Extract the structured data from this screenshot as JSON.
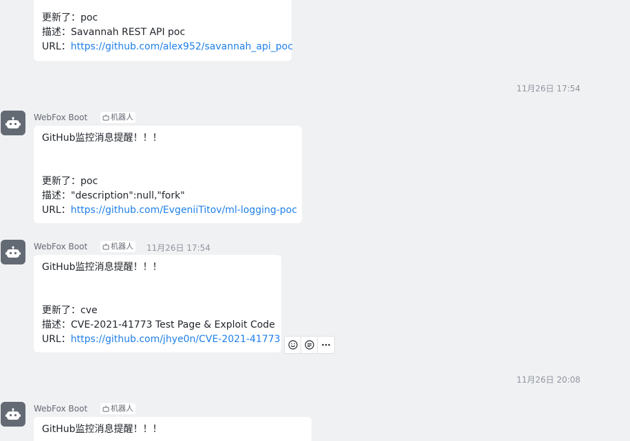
{
  "messages": [
    {
      "line_update": "更新了：poc",
      "desc": "描述：Savannah REST API poc",
      "url_prefix": "URL：",
      "url": "https://github.com/alex952/savannah_api_poc"
    },
    {
      "sender": "WebFox Boot",
      "badge": "机器人",
      "title": "GitHub监控消息提醒！！！",
      "line_update": "更新了：poc",
      "desc": "描述：\"description\":null,\"fork\"",
      "url_prefix": "URL：",
      "url": "https://github.com/EvgeniiTitov/ml-logging-poc"
    },
    {
      "sender": "WebFox Boot",
      "badge": "机器人",
      "time": "11月26日 17:54",
      "title": "GitHub监控消息提醒！！！",
      "line_update": "更新了：cve",
      "desc": "描述：CVE-2021-41773 Test Page & Exploit Code",
      "url_prefix": "URL：",
      "url": "https://github.com/jhye0n/CVE-2021-41773"
    },
    {
      "sender": "WebFox Boot",
      "badge": "机器人",
      "title": "GitHub监控消息提醒！！！"
    }
  ],
  "timestamps": [
    "11月26日 17:54",
    "11月26日 20:08"
  ],
  "actions": [
    {
      "icon": "emoji-reaction-icon"
    },
    {
      "icon": "reply-icon"
    },
    {
      "icon": "more-icon"
    }
  ],
  "colors": {
    "link": "#1e7fe8",
    "background": "#f0f1f3",
    "avatar": "#646a73"
  }
}
